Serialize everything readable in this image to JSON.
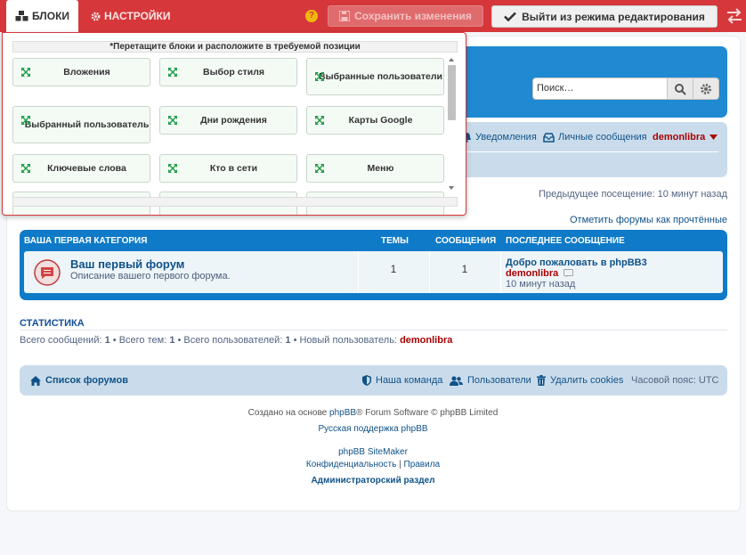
{
  "toolbar": {
    "tab_blocks": "БЛОКИ",
    "tab_settings": "НАСТРОЙКИ",
    "help": "?",
    "save_label": "Сохранить изменения",
    "exit_label": "Выйти из режима редактирования"
  },
  "blocks_panel": {
    "hint": "*Перетащите блоки и расположите в требуемой позиции",
    "items": [
      "Вложения",
      "Выбор стиля",
      "Выбранные пользователи",
      "Выбранный пользователь",
      "Дни рождения",
      "Карты Google",
      "Ключевые слова",
      "Кто в сети",
      "Меню"
    ]
  },
  "search": {
    "placeholder": "Поиск…"
  },
  "navbar": {
    "notifications": "Уведомления",
    "messages": "Личные сообщения",
    "user": "demonlibra"
  },
  "last_visit": "Предыдущее посещение: 10 минут назад",
  "mark_read": "Отметить форумы как прочтённые",
  "forum_table": {
    "category": "ВАША ПЕРВАЯ КАТЕГОРИЯ",
    "col_topics": "ТЕМЫ",
    "col_posts": "СООБЩЕНИЯ",
    "col_last": "ПОСЛЕДНЕЕ СООБЩЕНИЕ",
    "forum": {
      "title": "Ваш первый форум",
      "description": "Описание вашего первого форума.",
      "topics": "1",
      "posts": "1",
      "last_title": "Добро пожаловать в phpBB3",
      "last_user": "demonlibra",
      "last_time": "10 минут назад"
    }
  },
  "stats": {
    "heading": "СТАТИСТИКА",
    "posts_label": "Всего сообщений:",
    "posts": "1",
    "topics_label": "• Всего тем:",
    "topics": "1",
    "users_label": "• Всего пользователей:",
    "users": "1",
    "newest_label": "• Новый пользователь:",
    "newest": "demonlibra"
  },
  "footer_nav": {
    "forum_list": "Список форумов",
    "team": "Наша команда",
    "members": "Пользователи",
    "delete_cookies": "Удалить cookies",
    "timezone": "Часовой пояс: UTC"
  },
  "credits": {
    "line1_pre": "Создано на основе",
    "line1_link": "phpBB",
    "line1_post": "® Forum Software © phpBB Limited",
    "line2": "Русская поддержка phpBB",
    "line3": "phpBB SiteMaker",
    "privacy": "Конфиденциальность",
    "sep": "|",
    "rules": "Правила",
    "acp": "Администраторский раздел"
  },
  "colors": {
    "topbar": "#d6373a",
    "header": "#1f8ad2",
    "navbar": "#cadceb",
    "link": "#105289",
    "user": "#aa0000"
  }
}
